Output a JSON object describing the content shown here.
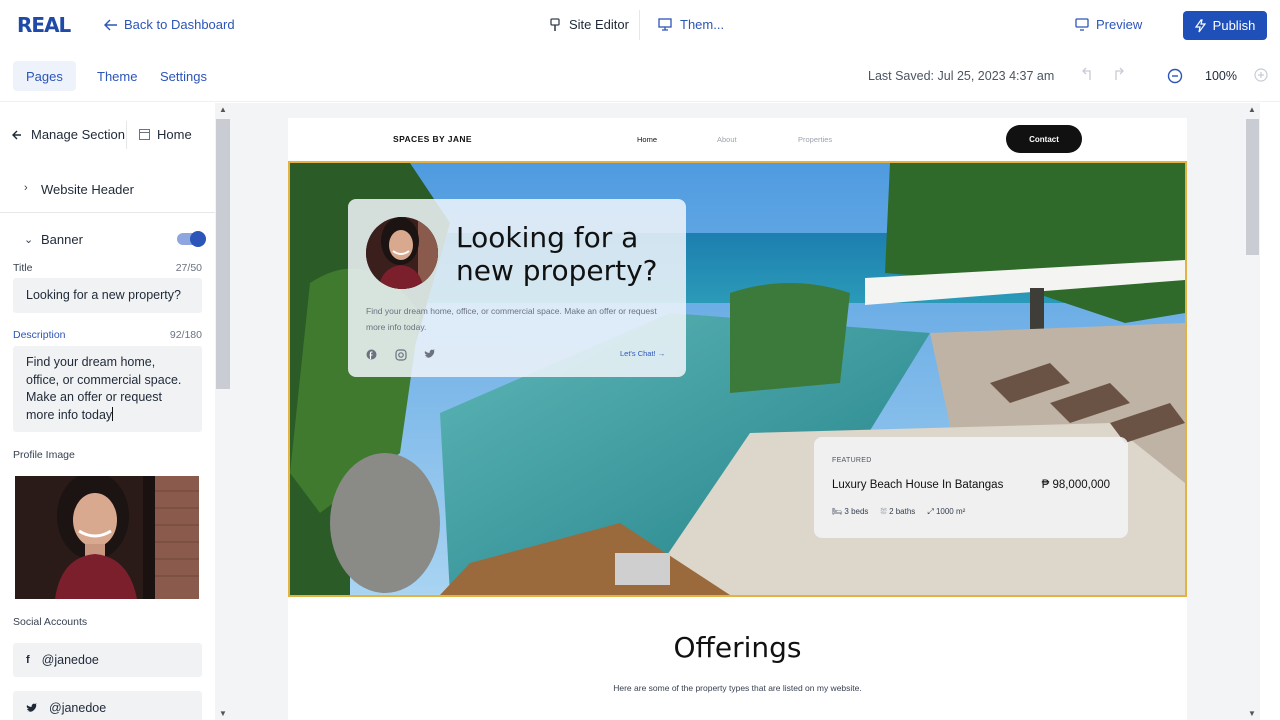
{
  "topbar": {
    "logo": "REAL",
    "back_label": "Back to Dashboard",
    "site_editor_label": "Site Editor",
    "theme_label": "Them...",
    "preview_label": "Preview",
    "publish_label": "Publish"
  },
  "subbar": {
    "tabs": [
      {
        "label": "Pages",
        "active": true
      },
      {
        "label": "Theme",
        "active": false
      },
      {
        "label": "Settings",
        "active": false
      }
    ],
    "last_saved": "Last Saved: Jul 25, 2023 4:37 am",
    "zoom": "100%"
  },
  "sidebar": {
    "manage_label": "Manage Section",
    "home_label": "Home",
    "website_header_label": "Website Header",
    "banner_label": "Banner",
    "banner_enabled": true,
    "title_label": "Title",
    "title_count": "27/50",
    "title_value": "Looking for a new property?",
    "description_label": "Description",
    "description_count": "92/180",
    "description_value": "Find your dream home, office, or commercial space. Make an offer or request more info today",
    "profile_image_label": "Profile Image",
    "social_accounts_label": "Social Accounts",
    "socials": [
      {
        "icon": "facebook-icon",
        "handle": "@janedoe"
      },
      {
        "icon": "twitter-icon",
        "handle": "@janedoe"
      }
    ]
  },
  "preview_page": {
    "brand": "SPACES BY JANE",
    "nav": [
      "Home",
      "About",
      "Properties"
    ],
    "contact_label": "Contact",
    "hero": {
      "title": "Looking for a new property?",
      "description": "Find your dream home, office, or commercial space. Make an offer or request more info today.",
      "cta": "Let's Chat! →",
      "featured": {
        "tag": "FEATURED",
        "name": "Luxury Beach House In Batangas",
        "price": "₱ 98,000,000",
        "beds": "3 beds",
        "baths": "2 baths",
        "area": "1000 m²"
      }
    },
    "offerings_title": "Offerings",
    "offerings_subtitle": "Here are some of the property types that are listed on my website."
  },
  "colors": {
    "accent": "#1f4fb8",
    "selection_outline": "#e3b341"
  }
}
